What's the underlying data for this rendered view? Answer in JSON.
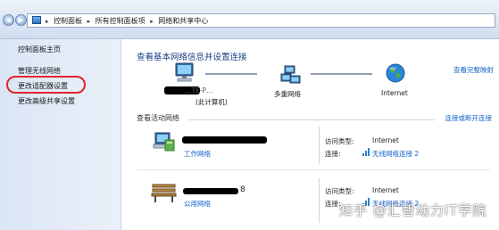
{
  "breadcrumb": {
    "items": [
      "控制面板",
      "所有控制面板项",
      "网络和共享中心"
    ]
  },
  "sidebar": {
    "home": "控制面板主页",
    "items": [
      "管理无线网络",
      "更改适配器设置",
      "更改高级共享设置"
    ],
    "highlight_color": "#e0242b"
  },
  "main": {
    "heading": "查看基本网络信息并设置连接",
    "full_map_link": "查看完整映射",
    "map": {
      "computer_label": "(此计算机)",
      "computer_name_partial": "…TE-P…",
      "middle_label": "多重网络",
      "internet_label": "Internet"
    },
    "active_section": {
      "title": "查看活动网络",
      "connect_link": "连接或断开连接"
    },
    "networks": [
      {
        "name_suffix": "",
        "type": "工作网络",
        "access_key": "访问类型:",
        "access_value": "Internet",
        "conn_key": "连接:",
        "conn_value": "无线网络连接 2",
        "icon": "work-network-icon"
      },
      {
        "name_suffix": "8",
        "type": "公用网络",
        "access_key": "访问类型:",
        "access_value": "Internet",
        "conn_key": "连接:",
        "conn_value": "无线网络连接 2",
        "icon": "park-bench-icon"
      }
    ]
  },
  "watermark": "知乎 @汇智动力IT学院",
  "colors": {
    "link": "#1060c9",
    "heading": "#1a3e83",
    "sidebar_bg": "#dbe6f5"
  }
}
